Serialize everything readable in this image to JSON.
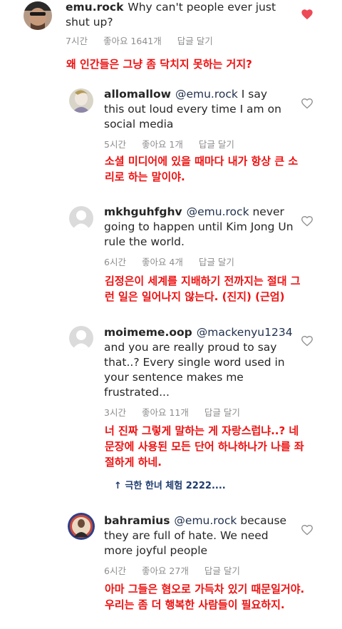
{
  "comments": [
    {
      "username": "emu.rock",
      "mention": "",
      "text": "Why can't people ever just shut up?",
      "time": "7시간",
      "likes": "좋아요 1641개",
      "reply": "답글 달기",
      "liked": true,
      "translation": "왜 인간들은 그냥 좀 닥치지 못하는 거지?"
    },
    {
      "username": "allomallow",
      "mention": "@emu.rock",
      "text": "I say this out loud every time I am on social media",
      "time": "5시간",
      "likes": "좋아요 1개",
      "reply": "답글 달기",
      "liked": false,
      "translation": "소셜 미디어에 있을 때마다 내가 항상 큰 소리로 하는 말이야."
    },
    {
      "username": "mkhguhfghv",
      "mention": "@emu.rock",
      "text": "never going to happen until Kim Jong Un rule the world.",
      "time": "6시간",
      "likes": "좋아요 4개",
      "reply": "답글 달기",
      "liked": false,
      "translation": "김정은이 세계를 지배하기 전까지는 절대 그런 일은 일어나지 않는다. (진지) (근엄)"
    },
    {
      "username": "moimeme.oop",
      "mention": "@mackenyu1234",
      "text": "and you are really proud to say that..? Every single word used in your sentence makes me frustrated...",
      "time": "3시간",
      "likes": "좋아요 11개",
      "reply": "답글 달기",
      "liked": false,
      "translation": "너 진짜 그렇게 말하는 게 자랑스럽냐..? 네 문장에 사용된 모든 단어 하나하나가 나를 좌절하게 하네."
    },
    {
      "username": "bahramius",
      "mention": "@emu.rock",
      "text": "because they are full of hate. We need more joyful people",
      "time": "6시간",
      "likes": "좋아요 27개",
      "reply": "답글 달기",
      "liked": false,
      "translation": "아마 그들은 혐오로 가득차 있기 때문일거야. 우리는 좀 더 행복한 사람들이 필요하지."
    }
  ],
  "replies_link": "↑ 극한 한녀 체험 2222....",
  "colors": {
    "liked_heart": "#ed4956",
    "translation": "#ee1111",
    "meta": "#8e8e8e"
  }
}
